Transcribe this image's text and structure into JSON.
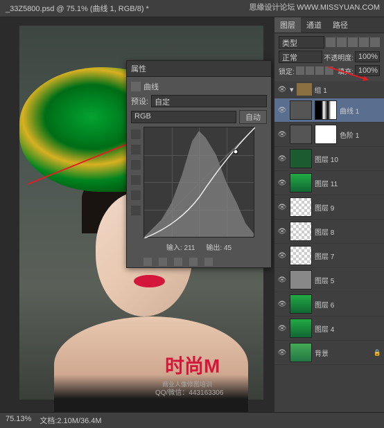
{
  "watermark": {
    "text1": "思缘设计论坛",
    "text2": "WWW.MISSYUAN.COM"
  },
  "tab_title": "_33Z5800.psd @ 75.1% (曲线 1, RGB/8) *",
  "status": {
    "zoom": "75.13%",
    "doc": "文档:2.10M/36.4M"
  },
  "properties": {
    "title": "属性",
    "type_label": "曲线",
    "preset_label": "预设:",
    "preset_value": "自定",
    "channel": "RGB",
    "auto": "自动",
    "input_label": "输入:",
    "input_value": "211",
    "output_label": "输出:",
    "output_value": "45"
  },
  "chart_data": {
    "type": "line",
    "title": "曲线",
    "xlabel": "输入",
    "ylabel": "输出",
    "xlim": [
      0,
      255
    ],
    "ylim": [
      0,
      255
    ],
    "curve_points": [
      [
        0,
        0
      ],
      [
        60,
        30
      ],
      [
        128,
        96
      ],
      [
        180,
        155
      ],
      [
        211,
        200
      ],
      [
        255,
        255
      ]
    ],
    "diagonal": [
      [
        0,
        0
      ],
      [
        255,
        255
      ]
    ],
    "histogram_peaks": [
      [
        20,
        10
      ],
      [
        40,
        25
      ],
      [
        60,
        50
      ],
      [
        80,
        90
      ],
      [
        100,
        140
      ],
      [
        120,
        155
      ],
      [
        130,
        145
      ],
      [
        150,
        120
      ],
      [
        170,
        80
      ],
      [
        190,
        50
      ],
      [
        210,
        30
      ],
      [
        230,
        15
      ],
      [
        250,
        5
      ]
    ]
  },
  "layers_panel": {
    "tabs": [
      "图层",
      "通道",
      "路径"
    ],
    "kind": "类型",
    "blend_mode": "正常",
    "opacity_label": "不透明度:",
    "opacity": "100%",
    "lock_label": "锁定:",
    "fill_label": "填充:",
    "fill": "100%",
    "group": "组 1",
    "layers": [
      {
        "name": "曲线 1",
        "type": "adj",
        "selected": true,
        "mask": "dark"
      },
      {
        "name": "色阶 1",
        "type": "adj",
        "mask": "white"
      },
      {
        "name": "图层 10",
        "type": "solid",
        "color": "#1b5b2f"
      },
      {
        "name": "图层 11",
        "type": "img"
      },
      {
        "name": "图层 9",
        "type": "trans"
      },
      {
        "name": "图层 8",
        "type": "trans"
      },
      {
        "name": "图层 7",
        "type": "trans"
      },
      {
        "name": "图层 5",
        "type": "gray"
      },
      {
        "name": "图层 6",
        "type": "img"
      },
      {
        "name": "图层 4",
        "type": "img"
      },
      {
        "name": "背景",
        "type": "img",
        "locked": true
      }
    ]
  },
  "logo": {
    "main": "时尚M",
    "sub": "商业人像修图培训",
    "qq": "QQ/微信：443163306"
  }
}
